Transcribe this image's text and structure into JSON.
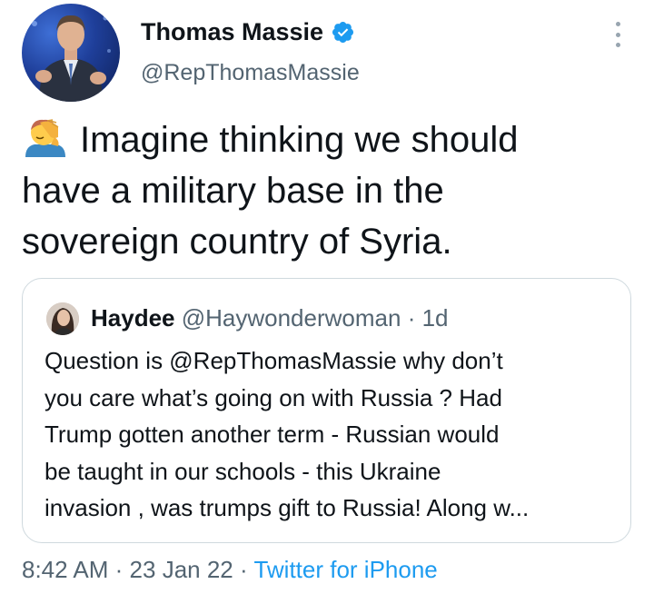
{
  "author": {
    "display_name": "Thomas Massie",
    "handle": "@RepThomasMassie",
    "verified": true
  },
  "tweet": {
    "emoji": "face-palm-emoji",
    "lines": [
      "Imagine thinking we should",
      "have a military base in the",
      "sovereign country of Syria."
    ]
  },
  "quoted_tweet": {
    "display_name": "Haydee",
    "handle": "@Haywonderwoman",
    "separator": "·",
    "time": "1d",
    "lines": [
      "Question is @RepThomasMassie why don’t",
      "you care what’s going on with Russia ? Had",
      "Trump gotten another term - Russian would",
      "be taught in our schools - this Ukraine",
      "invasion , was trumps gift to Russia! Along w..."
    ]
  },
  "meta": {
    "time": "8:42 AM",
    "separator": "·",
    "date": "23 Jan 22",
    "source": "Twitter for iPhone"
  },
  "colors": {
    "text": "#0f1419",
    "secondary": "#536471",
    "link": "#1d9bf0",
    "border": "#cfd9de"
  }
}
